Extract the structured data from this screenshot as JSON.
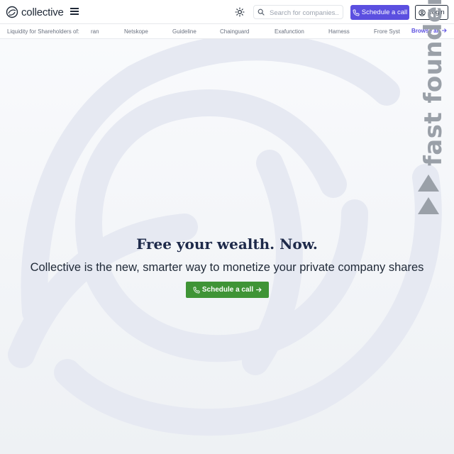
{
  "brand": {
    "name": "collective",
    "logo_icon": "collective-ring-logo"
  },
  "header": {
    "menu_icon": "hamburger-menu-icon",
    "theme_icon": "sun-icon",
    "search": {
      "placeholder": "Search for companies..",
      "value": "",
      "icon": "search-icon"
    },
    "schedule_label": "Schedule a call",
    "schedule_icon": "phone-icon",
    "login_label": "Login",
    "login_icon": "user-circle-icon"
  },
  "ticker": {
    "label": "Liquidity for Shareholders of:",
    "items": [
      "ran",
      "Netskope",
      "Guideline",
      "Chainguard",
      "Exafunction",
      "Harness",
      "Frore Syst"
    ],
    "browse_label": "Browse all",
    "browse_icon": "arrow-right-icon"
  },
  "badge": {
    "text": "fast founder",
    "icon": "play-triangles-icon"
  },
  "hero": {
    "title": "Free your wealth. Now.",
    "subtitle": "Collective is the new, smarter way to monetize your private company shares",
    "cta_label": "Schedule a call",
    "cta_icons": [
      "phone-icon",
      "arrow-right-icon"
    ]
  },
  "colors": {
    "primary": "#5b4fe0",
    "cta_green": "#3f9436",
    "title_navy": "#1e2a4a",
    "bg_ring": "#e6e9f1"
  }
}
